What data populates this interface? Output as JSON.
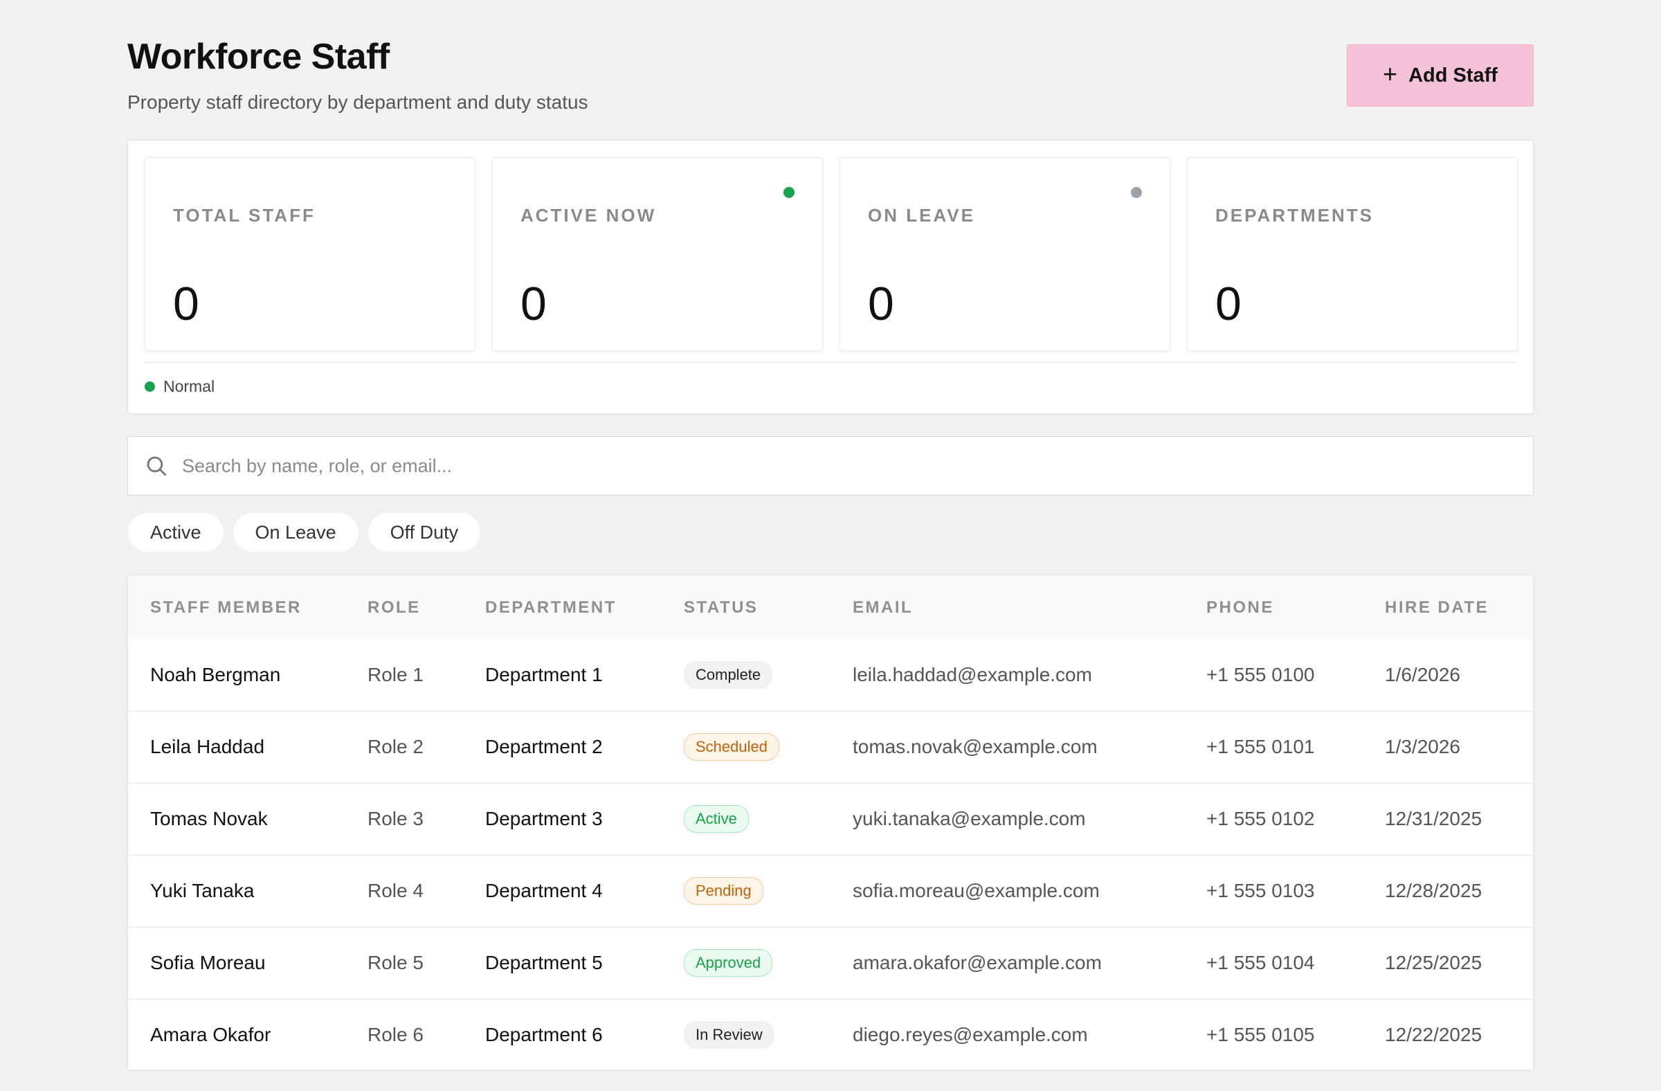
{
  "header": {
    "title": "Workforce Staff",
    "subtitle": "Property staff directory by department and duty status",
    "add_button_icon": "plus-icon",
    "add_button_label": "Add Staff",
    "add_button_color": "#f6c2d9"
  },
  "stats": [
    {
      "label": "TOTAL STAFF",
      "value": "0"
    },
    {
      "label": "ACTIVE NOW",
      "value": "0",
      "indicator_color": "#16a34a"
    },
    {
      "label": "ON LEAVE",
      "value": "0",
      "indicator_color": "#9ca3af"
    },
    {
      "label": "DEPARTMENTS",
      "value": "0"
    }
  ],
  "legend": {
    "label": "Normal",
    "color": "#16a34a"
  },
  "search": {
    "icon": "search-icon",
    "placeholder": "Search by name, role, or email...",
    "value": ""
  },
  "filters": [
    "Active",
    "On Leave",
    "Off Duty"
  ],
  "table": {
    "columns": [
      "STAFF MEMBER",
      "ROLE",
      "DEPARTMENT",
      "STATUS",
      "EMAIL",
      "PHONE",
      "HIRE DATE"
    ],
    "rows": [
      {
        "name": "Noah Bergman",
        "role": "Role 1",
        "department": "Department 1",
        "status": "Complete",
        "email": "leila.haddad@example.com",
        "phone": "+1 555 0100",
        "hire_date": "1/6/2026"
      },
      {
        "name": "Leila Haddad",
        "role": "Role 2",
        "department": "Department 2",
        "status": "Scheduled",
        "email": "tomas.novak@example.com",
        "phone": "+1 555 0101",
        "hire_date": "1/3/2026"
      },
      {
        "name": "Tomas Novak",
        "role": "Role 3",
        "department": "Department 3",
        "status": "Active",
        "email": "yuki.tanaka@example.com",
        "phone": "+1 555 0102",
        "hire_date": "12/31/2025"
      },
      {
        "name": "Yuki Tanaka",
        "role": "Role 4",
        "department": "Department 4",
        "status": "Pending",
        "email": "sofia.moreau@example.com",
        "phone": "+1 555 0103",
        "hire_date": "12/28/2025"
      },
      {
        "name": "Sofia Moreau",
        "role": "Role 5",
        "department": "Department 5",
        "status": "Approved",
        "email": "amara.okafor@example.com",
        "phone": "+1 555 0104",
        "hire_date": "12/25/2025"
      },
      {
        "name": "Amara Okafor",
        "role": "Role 6",
        "department": "Department 6",
        "status": "In Review",
        "email": "diego.reyes@example.com",
        "phone": "+1 555 0105",
        "hire_date": "12/22/2025"
      }
    ]
  }
}
